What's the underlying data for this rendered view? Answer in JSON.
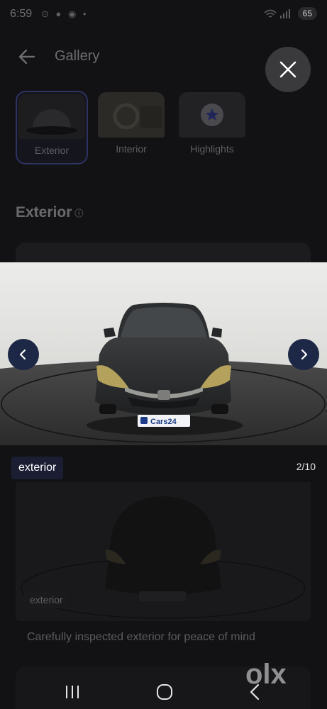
{
  "status_bar": {
    "time": "6:59",
    "left_icons": "⊙ ● ◉ •",
    "battery": "65"
  },
  "header": {
    "title": "Gallery"
  },
  "tabs": [
    {
      "label": "Exterior",
      "active": true
    },
    {
      "label": "Interior",
      "active": false
    },
    {
      "label": "Highlights",
      "active": false
    }
  ],
  "section": {
    "title": "Exterior",
    "info_glyph": "ⓘ"
  },
  "viewer": {
    "plate": "Cars24",
    "caption": "exterior",
    "counter": "2/10"
  },
  "card": {
    "chip": "exterior",
    "description": "Carefully inspected exterior for peace of mind"
  },
  "watermark": "olx",
  "icons": {
    "back": "arrow-left-icon",
    "close": "close-icon",
    "prev": "chevron-left-icon",
    "next": "chevron-right-icon",
    "recents": "recents-icon",
    "home": "home-icon",
    "nav_back": "nav-back-icon"
  },
  "colors": {
    "nav_button": "#1d2847",
    "caption_bg": "#1b1e33",
    "active_tab_border": "#2d3260"
  }
}
